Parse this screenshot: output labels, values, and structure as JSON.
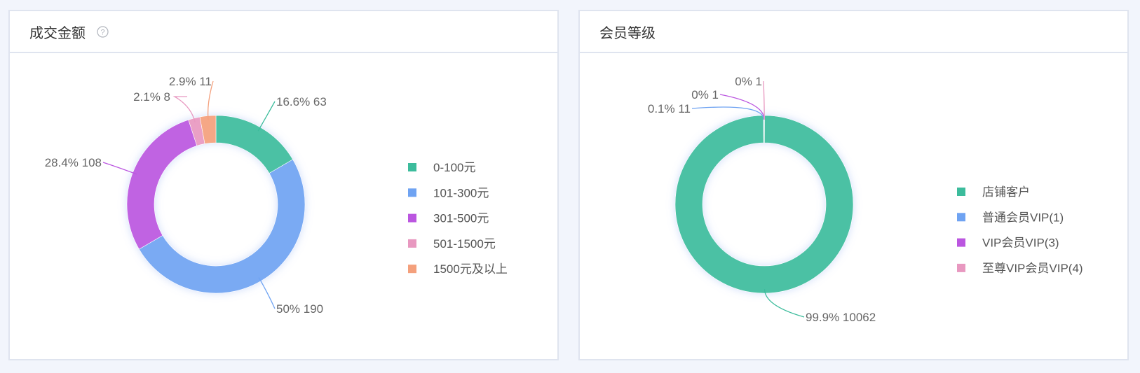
{
  "panels": [
    {
      "title": "成交金额",
      "help_icon": "question-circle-icon"
    },
    {
      "title": "会员等级"
    }
  ],
  "chart_data": [
    {
      "type": "pie",
      "title": "成交金额",
      "donut": true,
      "categories": [
        "0-100元",
        "101-300元",
        "301-500元",
        "501-1500元",
        "1500元及以上"
      ],
      "values": [
        63,
        190,
        108,
        8,
        11
      ],
      "percent_labels": [
        "16.6%",
        "50%",
        "28.4%",
        "2.1%",
        "2.9%"
      ],
      "data_labels": [
        "16.6% 63",
        "50% 190",
        "28.4% 108",
        "2.1% 8",
        "2.9% 11"
      ],
      "colors": [
        "#3cbc9c",
        "#6fa3f2",
        "#bb56e0",
        "#e898c0",
        "#f4a07c"
      ],
      "legend": "right"
    },
    {
      "type": "pie",
      "title": "会员等级",
      "donut": true,
      "categories": [
        "店铺客户",
        "普通会员VIP(1)",
        "VIP会员VIP(3)",
        "至尊VIP会员VIP(4)"
      ],
      "values": [
        10062,
        11,
        1,
        1
      ],
      "percent_labels": [
        "99.9%",
        "0.1%",
        "0%",
        "0%"
      ],
      "data_labels": [
        "99.9% 10062",
        "0.1% 11",
        "0% 1",
        "0% 1"
      ],
      "colors": [
        "#3cbc9c",
        "#6fa3f2",
        "#bb56e0",
        "#e898c0"
      ],
      "legend": "right"
    }
  ]
}
